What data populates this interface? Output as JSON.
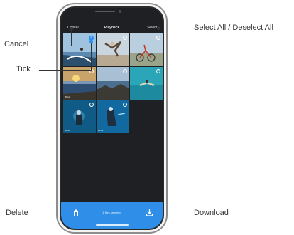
{
  "screen": {
    "cancel_label": "Cancel",
    "title": "Playback",
    "select_label": "Select",
    "files_selected": "1 files selected"
  },
  "thumbnails": [
    {
      "scene": "surfing-coast",
      "selected": true,
      "duration": ""
    },
    {
      "scene": "jumper-beach",
      "selected": false,
      "duration": ""
    },
    {
      "scene": "cyclist",
      "selected": false,
      "duration": ""
    },
    {
      "scene": "sunset-sea",
      "selected": false,
      "duration": "00:12"
    },
    {
      "scene": "rock-shore",
      "selected": false,
      "duration": ""
    },
    {
      "scene": "diver-ocean",
      "selected": false,
      "duration": ""
    },
    {
      "scene": "diver-left",
      "selected": false,
      "duration": "00:34"
    },
    {
      "scene": "diver-right",
      "selected": false,
      "duration": "00:21"
    }
  ],
  "icons": {
    "delete": "trash-icon",
    "download": "download-icon"
  },
  "callouts": {
    "cancel": "Cancel",
    "tick": "Tick",
    "select_all": "Select All / Deselect All",
    "delete": "Delete",
    "download": "Download"
  },
  "colors": {
    "accent": "#2f8ee8",
    "screen_bg": "#1e2024"
  }
}
